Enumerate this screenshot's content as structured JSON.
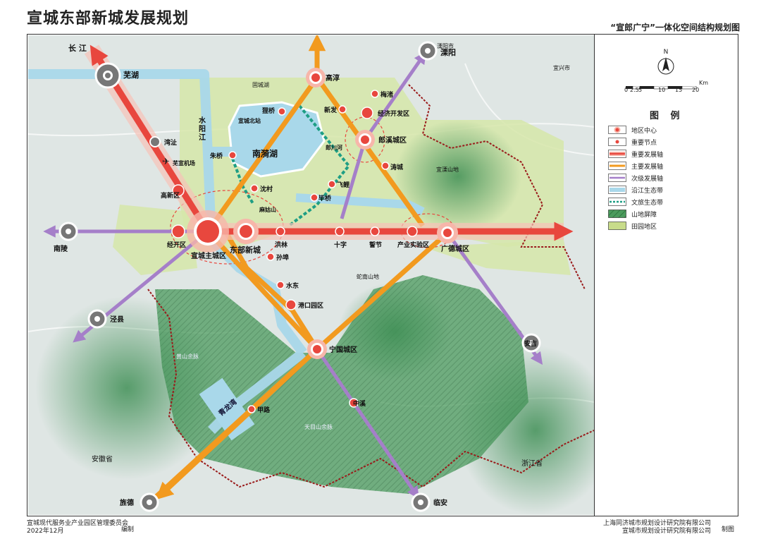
{
  "title": "宣城东部新城发展规划",
  "subtitle": "“宣郎广宁”一体化空间结构规划图",
  "footer": {
    "org_left": "宣城现代服务业产业园区管理委员会",
    "date": "2022年12月",
    "compile": "编制",
    "org_right_1": "上海同济城市规划设计研究院有限公司",
    "org_right_2": "宣城市规划设计研究院有限公司",
    "make": "制图"
  },
  "north": "N",
  "scale": {
    "unit": "Km",
    "ticks": [
      "0",
      "2.5",
      "5",
      "10",
      "15",
      "20"
    ]
  },
  "legend": {
    "title": "图 例",
    "items": [
      {
        "label": "地区中心",
        "icon": "regional-center-icon"
      },
      {
        "label": "重要节点",
        "icon": "important-node-icon"
      },
      {
        "label": "重要发展轴",
        "icon": "major-axis-icon"
      },
      {
        "label": "主要发展轴",
        "icon": "main-axis-icon"
      },
      {
        "label": "次级发展轴",
        "icon": "secondary-axis-icon"
      },
      {
        "label": "沿江生态带",
        "icon": "riverside-eco-belt-icon"
      },
      {
        "label": "文旅生态带",
        "icon": "cultural-tourism-belt-icon"
      },
      {
        "label": "山地屏障",
        "icon": "mountain-barrier-icon"
      },
      {
        "label": "田园地区",
        "icon": "pastoral-area-icon"
      }
    ]
  },
  "colors": {
    "major_axis": "#e8473e",
    "main_axis": "#f29a1f",
    "secondary_axis": "#a57fc9",
    "eco_belt": "#a9d8ea",
    "culture_belt": "#1e9e84",
    "mountain": "#3c8f4f",
    "pastoral": "#c8dc8a",
    "node": "#e8473e",
    "boundary": "#9a1b1b"
  },
  "map_labels": {
    "changjiang": "长\n江",
    "wuhu": "芜湖",
    "gaochun": "高淳",
    "liyang": "溧阳",
    "xiezhi": "湾沚",
    "wuxuan_airport": "芜宣机场",
    "shuiyang_river": "水\n阳\nJ江",
    "xuancheng_north": "宣城北站",
    "lidian": "狸桥",
    "xinfa": "新发",
    "meizhu": "梅渚",
    "econ_zone": "经济开发区",
    "langxi": "郎溪城区",
    "taocheng": "涛城",
    "nanyi_lake": "南漪湖",
    "langchuan_river": "郎川河",
    "zhuqiao": "朱桥",
    "shencun": "沈村",
    "feili": "飞鲤",
    "biqiao": "毕桥",
    "magushan": "麻姑山",
    "gaoxin": "高新区",
    "jingkai": "经开区",
    "xuancheng_main": "宣城主城区",
    "east_new_city": "东部新城",
    "honglin": "洪林",
    "shizi": "十字",
    "hanjie": "誓节",
    "industry_zone": "产业实验区",
    "guangde": "广德城区",
    "nanling": "南陵",
    "sunbu": "孙埠",
    "shuidong": "水东",
    "port_zone": "港口园区",
    "jingxian": "泾县",
    "ningguo": "宁国城区",
    "anji": "安吉",
    "qinglong_bay": "青龙湾",
    "jialu": "甲路",
    "zhongxi": "中溪",
    "jingting": "旌德",
    "linan": "临安",
    "anhui": "安徽省",
    "zhejiang": "浙江省",
    "huangshan_range": "黄山余脉",
    "tianmu_range": "天目山余脉",
    "zhiling_mtn": "蛇南山地",
    "yixi_mtn": "宜溧山地",
    "guchenghu": "固城湖",
    "yixing": "宜兴市",
    "liyang_city": "溧阳市"
  }
}
